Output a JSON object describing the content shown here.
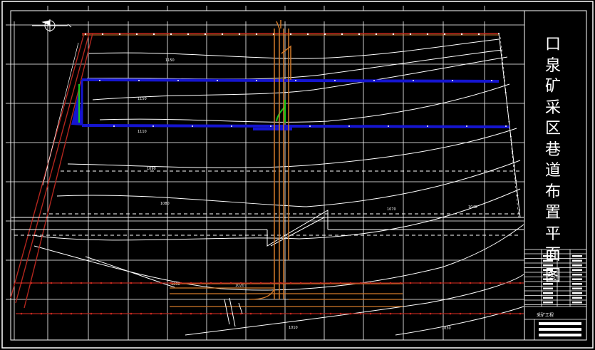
{
  "drawing": {
    "title_chars": [
      "口",
      "泉",
      "矿",
      "采",
      "区",
      "巷",
      "道",
      "布",
      "置",
      "平",
      "面",
      "图"
    ],
    "contour_labels": [
      "1150",
      "1150",
      "1110",
      "1090",
      "1080",
      "1070",
      "1040",
      "1030",
      "1020",
      "1010",
      "1030"
    ],
    "north_arrow": "north-arrow-icon",
    "footer_label": "采矿工程",
    "colors": {
      "background": "#000000",
      "frame": "#ffffff",
      "grid": "#ffffff",
      "roadway_main": "#1515d0",
      "roadway_shaft": "#d27a2a",
      "boundary": "#c8281e",
      "transport": "#b3261e",
      "contour": "#ffffff",
      "highlight": "#18c818"
    }
  }
}
